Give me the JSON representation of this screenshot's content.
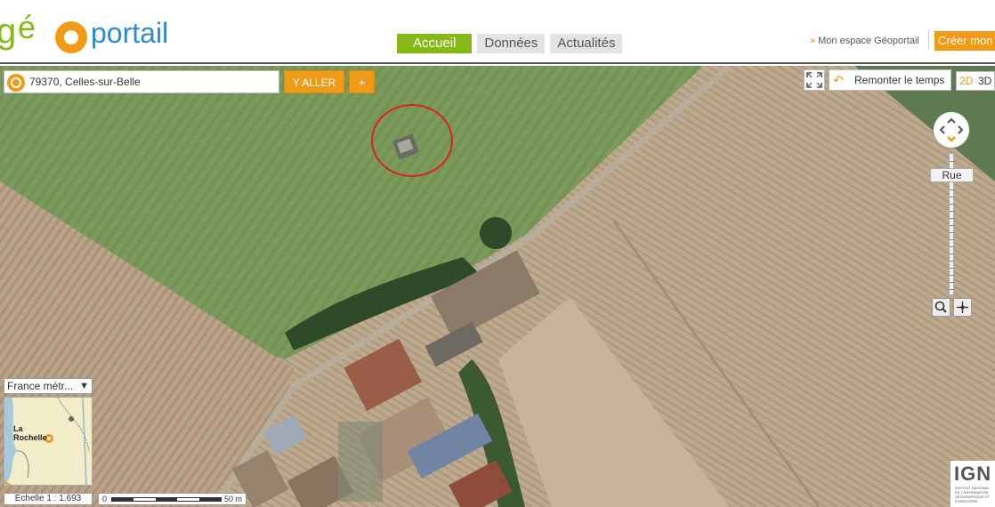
{
  "header": {
    "logo": {
      "prefix": "géo",
      "suffix": "portail"
    },
    "nav_tabs": [
      {
        "label": "Accueil",
        "active": true
      },
      {
        "label": "Données",
        "active": false
      },
      {
        "label": "Actualités",
        "active": false
      }
    ],
    "espace_link": "Mon espace Géoportail",
    "create_button": "Créer mon"
  },
  "search": {
    "value": "79370, Celles-sur-Belle",
    "go_label": "Y ALLER",
    "plus_label": "+"
  },
  "controls": {
    "remonter_label": "Remonter le temps",
    "dim_2d": "2D",
    "dim_3d": "3D",
    "zoom_level_label": "Rue"
  },
  "overview": {
    "selector": "France métr...",
    "place_label": "La Rochelle"
  },
  "scale": {
    "text": "Echelle 1 :  1.693",
    "bar_start": "0",
    "bar_end": "50 m"
  },
  "ign": {
    "logo": "IGN",
    "subtitle": "Institut national de l'information géographique et forestière"
  },
  "colors": {
    "accent_orange": "#f09b18",
    "nav_active_green": "#86b817",
    "annotation_circle": "#e0201a"
  },
  "icons": [
    "location-target-icon",
    "fullscreen-icon",
    "undo-icon",
    "compass-icon",
    "zoom-box-icon",
    "center-icon",
    "chevron-down-icon"
  ]
}
